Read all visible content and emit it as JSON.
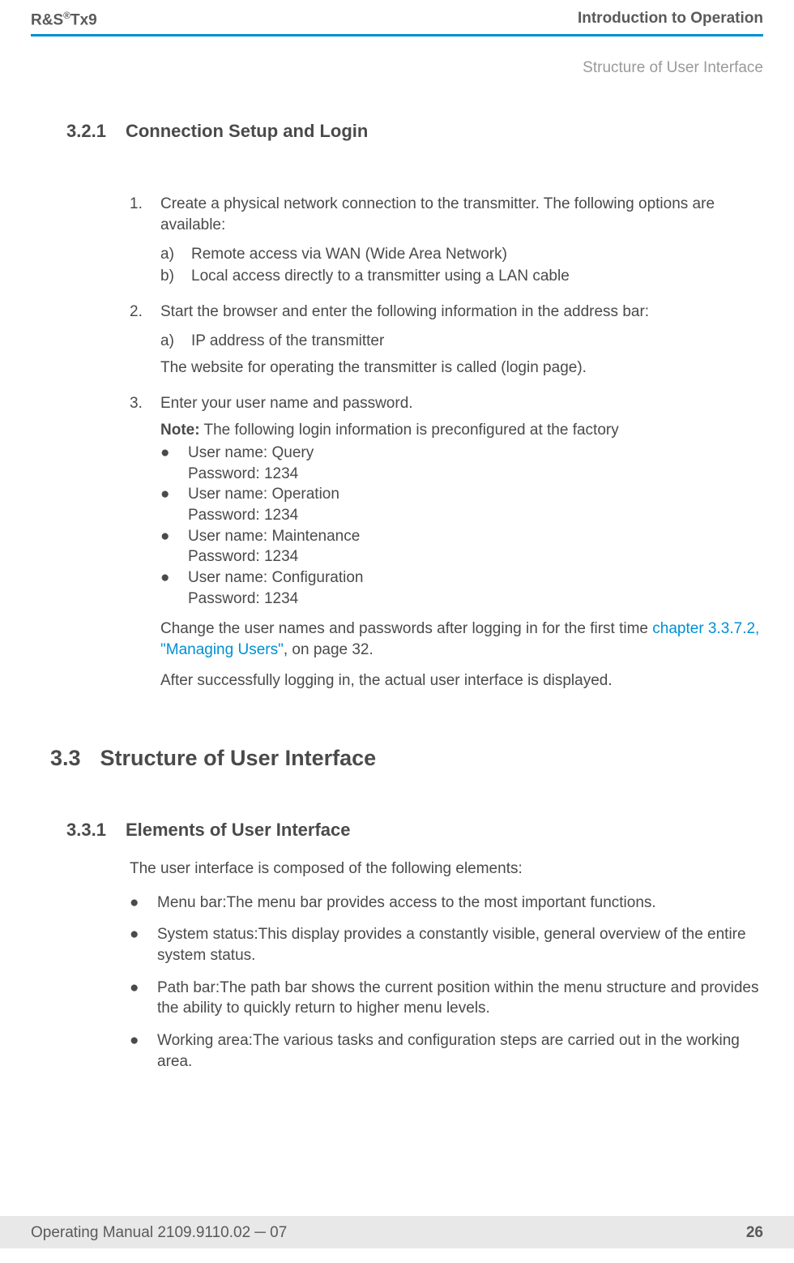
{
  "header": {
    "product_prefix": "R&S",
    "product_reg": "®",
    "product_suffix": "Tx9",
    "chapter_title": "Introduction to Operation",
    "section_name": "Structure of User Interface"
  },
  "s321": {
    "num": "3.2.1",
    "title": "Connection Setup and Login"
  },
  "steps": {
    "s1": {
      "n": "1.",
      "text": "Create a physical network connection to the transmitter. The following options are available:",
      "a": {
        "l": "a)",
        "t": "Remote access via WAN (Wide Area Network)"
      },
      "b": {
        "l": "b)",
        "t": "Local access directly to a transmitter using a LAN cable"
      }
    },
    "s2": {
      "n": "2.",
      "text": "Start the browser and enter the following information in the address bar:",
      "a": {
        "l": "a)",
        "t": "IP address of the transmitter"
      },
      "after": "The website for operating the transmitter is called (login page)."
    },
    "s3": {
      "n": "3.",
      "text": "Enter your user name and password.",
      "note_label": "Note:",
      "note_text": " The following login information is preconfigured at the factory",
      "creds": [
        {
          "u": "User name: Query",
          "p": "Password: 1234"
        },
        {
          "u": "User name: Operation",
          "p": "Password: 1234"
        },
        {
          "u": "User name: Maintenance",
          "p": "Password: 1234"
        },
        {
          "u": "User name: Configuration",
          "p": "Password: 1234"
        }
      ],
      "change1": "Change the user names and passwords after logging in for the first time ",
      "link": "chapter 3.3.7.2, \"Managing Users\"",
      "change2": ", on page 32.",
      "after": "After successfully logging in, the actual user interface is displayed."
    }
  },
  "s33": {
    "num": "3.3",
    "title": "Structure of User Interface"
  },
  "s331": {
    "num": "3.3.1",
    "title": "Elements of User Interface"
  },
  "elements": {
    "intro": "The user interface is composed of the following elements:",
    "items": [
      {
        "h": "Menu bar:",
        "d": "The menu bar provides access to the most important functions."
      },
      {
        "h": "System status:",
        "d": "This display provides a constantly visible, general overview of the entire system status."
      },
      {
        "h": "Path bar:",
        "d": "The path bar shows the current position within the menu structure and provides the ability to quickly return to higher menu levels."
      },
      {
        "h": "Working area:",
        "d": "The various tasks and configuration steps are carried out in the working area."
      }
    ]
  },
  "footer": {
    "left1": "Operating Manual 2109.9110.02 ",
    "left2": "─",
    "left3": " 07",
    "page": "26"
  },
  "bullet": "●"
}
